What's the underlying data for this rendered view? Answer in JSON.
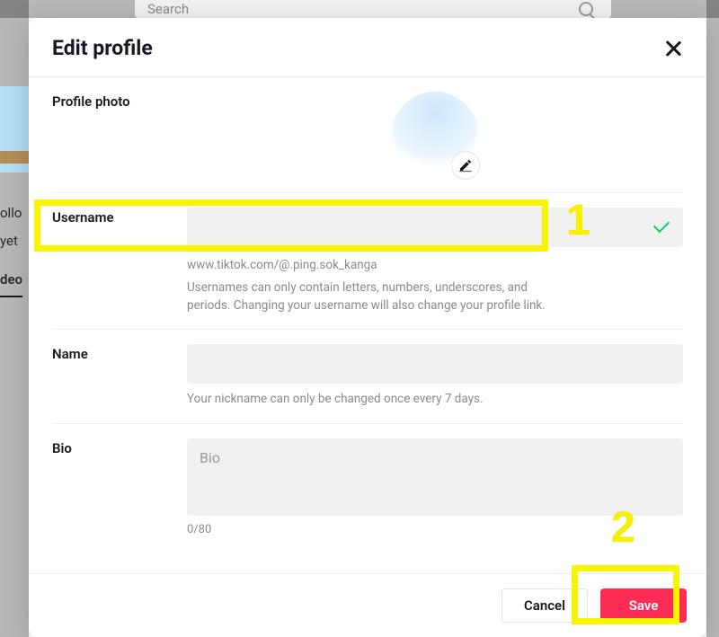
{
  "search": {
    "placeholder": "Search"
  },
  "background": {
    "follow_fragment": "ollo",
    "yet_fragment": "yet",
    "tab_fragment": "deo"
  },
  "modal": {
    "title": "Edit profile",
    "sections": {
      "photo": {
        "label": "Profile photo"
      },
      "username": {
        "label": "Username",
        "value": "",
        "url_text": "www.tiktok.com/@.ping.sok_kanga",
        "hint": "Usernames can only contain letters, numbers, underscores, and periods. Changing your username will also change your profile link."
      },
      "name": {
        "label": "Name",
        "value": "",
        "hint": "Your nickname can only be changed once every 7 days."
      },
      "bio": {
        "label": "Bio",
        "placeholder": "Bio",
        "counter": "0/80"
      }
    },
    "footer": {
      "cancel": "Cancel",
      "save": "Save"
    }
  },
  "annotations": {
    "step1_number": "1",
    "step2_number": "2"
  },
  "colors": {
    "primary": "#fe2c55",
    "highlight": "#f7f400",
    "valid_check": "#18c964"
  }
}
